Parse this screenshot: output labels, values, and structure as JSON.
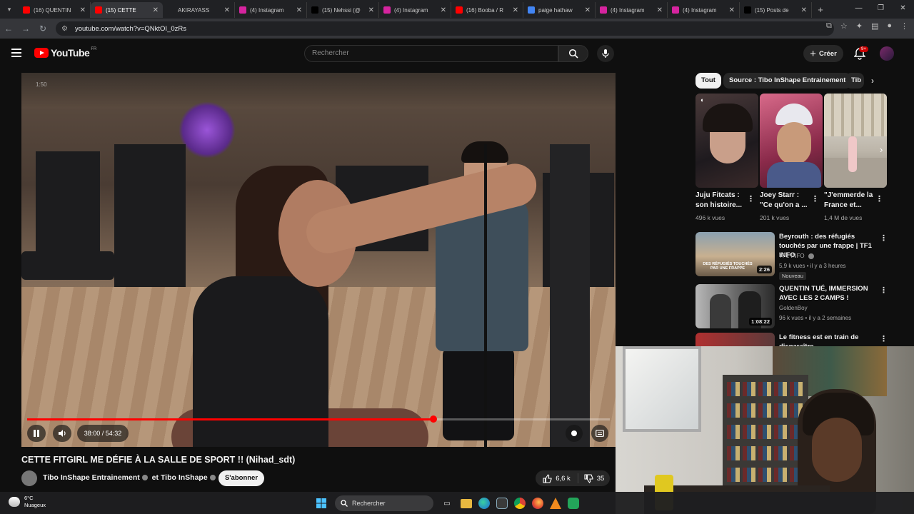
{
  "browser": {
    "tabs": [
      {
        "title": "(16) QUENTIN",
        "icon": "youtube-icon",
        "color": "#ff0000"
      },
      {
        "title": "(15) CETTE",
        "icon": "youtube-icon",
        "color": "#ff0000",
        "active": true
      },
      {
        "title": "AKIRAYASS",
        "icon": "a-icon",
        "color": "#202124"
      },
      {
        "title": "(4) Instagram",
        "icon": "instagram-icon",
        "color": "#d6249f"
      },
      {
        "title": "(15) Nehssi (@",
        "icon": "x-icon",
        "color": "#000000"
      },
      {
        "title": "(4) Instagram",
        "icon": "instagram-icon",
        "color": "#d6249f"
      },
      {
        "title": "(16) Booba / R",
        "icon": "youtube-icon",
        "color": "#ff0000"
      },
      {
        "title": "paige hathaw",
        "icon": "google-icon",
        "color": "#4285f4"
      },
      {
        "title": "(4) Instagram",
        "icon": "instagram-icon",
        "color": "#d6249f"
      },
      {
        "title": "(4) Instagram",
        "icon": "instagram-icon",
        "color": "#d6249f"
      },
      {
        "title": "(15) Posts de",
        "icon": "x-icon",
        "color": "#000000"
      }
    ],
    "url": "youtube.com/watch?v=QNktOI_0zRs"
  },
  "header": {
    "logo_text": "YouTube",
    "country": "FR",
    "search_placeholder": "Rechercher",
    "create_label": "Créer",
    "notif_count": "9+"
  },
  "video": {
    "corner_time": "1:50",
    "time_display": "38:00 / 54:32",
    "progress": 0.697,
    "title": "CETTE FITGIRL ME DÉFIE À LA SALLE DE SPORT !! (Nihad_sdt)",
    "channel_main": "Tibo InShape Entrainement",
    "channel_joiner": "et",
    "channel_second": "Tibo InShape",
    "subscribe_label": "S'abonner",
    "likes": "6,6 k",
    "comments": "35"
  },
  "chips": [
    {
      "label": "Tout",
      "active": true
    },
    {
      "label": "Source : Tibo InShape Entrainement",
      "active": false
    },
    {
      "label": "Tib",
      "active": false
    }
  ],
  "shorts": [
    {
      "title": "Juju Fitcats : son histoire...",
      "views": "496 k vues"
    },
    {
      "title": "Joey Starr : \"Ce qu'on a ...",
      "views": "201 k vues"
    },
    {
      "title": "\"J'emmerde la France et...",
      "views": "1,4 M de vues"
    }
  ],
  "related": [
    {
      "title": "Beyrouth : des réfugiés touchés par une frappe | TF1 INFO",
      "channel": "TF1 INFO",
      "meta": "5,9 k vues • il y a 3 heures",
      "duration": "2:26",
      "badge": "Nouveau",
      "thumb_text": "DES RÉFUGIÉS TOUCHÉS PAR UNE FRAPPE"
    },
    {
      "title": "QUENTIN TUÉ, IMMERSION AVEC LES 2 CAMPS !",
      "channel": "GoldenBoy",
      "meta": "96 k vues • il y a 2 semaines",
      "duration": "1:08:22"
    },
    {
      "title": "Le fitness est en train de disparaître",
      "channel": "",
      "meta": ""
    }
  ],
  "taskbar": {
    "temp": "6°C",
    "weather": "Nuageux",
    "search_label": "Rechercher"
  }
}
